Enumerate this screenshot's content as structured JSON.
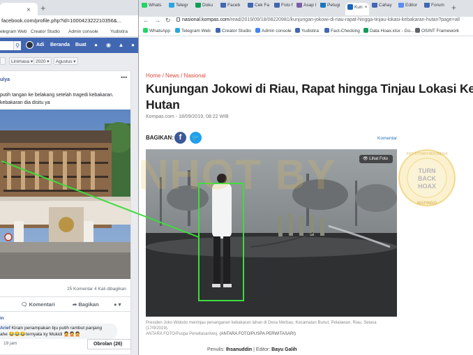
{
  "left_window": {
    "tab_close": "×",
    "tab_new": "+",
    "url": "facebook.com/profile.php?id=100042322210356&...",
    "bookmarks": [
      "elegram Web",
      "Creator Studio",
      "Admin console",
      "Yudistira"
    ],
    "fb_search_icon": "search-icon",
    "fb_user": "Adi",
    "fb_nav": [
      "Beranda",
      "Buat"
    ],
    "filters": [
      "Linimasa",
      "2020",
      "Agustus"
    ],
    "post": {
      "name": "ulya",
      "more": "•••",
      "text_line1": "putih tangan ke belakang setelah tragedi kebakaran.",
      "text_line2": "kebakaran dia disitu ya",
      "counts": "25 Komentar  4 Kali dibagikan",
      "action_comment": "Komentari",
      "action_share": "Bagikan",
      "comment_header": "in",
      "comment_author": "Arief",
      "comment_text": " Kirain penampakan bju putih rambut panjang",
      "comment_text2": "ahe 😂😂😂ternyata ky Mukidi 🤦🤦🤦",
      "comment_time": "19 jam",
      "chat_label": "Obrolan (26)"
    }
  },
  "right_window": {
    "tabs": [
      {
        "label": "Whats",
        "color": "#25d366"
      },
      {
        "label": "Telegr",
        "color": "#2ca5e0"
      },
      {
        "label": "Doku",
        "color": "#0f9d58"
      },
      {
        "label": "Faceb",
        "color": "#4267b2"
      },
      {
        "label": "Cek Fa",
        "color": "#4267b2"
      },
      {
        "label": "Foto f",
        "color": "#4267b2"
      },
      {
        "label": "Asap l",
        "color": "#7b5ea7"
      },
      {
        "label": "Petugi",
        "color": "#1b75bc"
      },
      {
        "label": "Kun",
        "color": "#1565c0"
      },
      {
        "label": "Cahay",
        "color": "#4267b2"
      },
      {
        "label": "Editor",
        "color": "#5a8dee"
      },
      {
        "label": "Forum",
        "color": "#4267b2"
      }
    ],
    "tab_new": "+",
    "back_icon": "←",
    "forward_icon": "→",
    "reload_icon": "↻",
    "url_host": "nasional.kompas.com",
    "url_path": "/read/2019/09/18/08220981/kunjungan-jokowi-di-riau-rapat-hingga-tinjau-lokasi-kebakaran-hutan?page=all",
    "bookmarks": [
      {
        "label": "WhatsApp",
        "color": "#25d366"
      },
      {
        "label": "Telegram Web",
        "color": "#2ca5e0"
      },
      {
        "label": "Creator Studio",
        "color": "#4267b2"
      },
      {
        "label": "Admin console",
        "color": "#4285f4"
      },
      {
        "label": "Yudistira",
        "color": "#4267b2"
      },
      {
        "label": "Fact-Checking",
        "color": "#4267b2"
      },
      {
        "label": "Data Hoax.xlsx - Go...",
        "color": "#0f9d58"
      },
      {
        "label": "OSINT Framework",
        "color": "#5f6368"
      }
    ],
    "breadcrumb": "Home / News / Nasional",
    "headline_line1": "Kunjungan Jokowi di Riau, Rapat hingga Tinjau Lokasi Kebakaran",
    "headline_line2": "Hutan",
    "meta": "Kompas.com - 18/09/2019, 08:22 WIB",
    "share_label": "BAGIKAN:",
    "fb_share": "f",
    "tw_share": "🐦",
    "komentar": "Komentar",
    "lihat_foto": "👁 Lihat Foto",
    "caption": "Presiden Joko Widodo meninjau penanganan kebakaran lahan di Desa Merbau, Kecamatan Bunut, Pelalawan, Riau, Selasa (17/9/2019).",
    "caption_credit": "ANTARA FOTO/Puspa Perwitasari/wsj.",
    "caption_credit_bold": "(ANTARA FOTO/PUSPA PERWITASARI)",
    "penulis_label": "Penulis: ",
    "penulis": "Ihsanuddin",
    "editor_label": " | Editor: ",
    "editor": "Bayu Galih"
  },
  "watermark": {
    "text": "NHOT BY",
    "seal_lines": [
      "TURN",
      "BACK",
      "HOAX"
    ],
    "seal_ring_top": "ANTI FITNAH INDONESIA",
    "seal_ring_bottom": "MAFINDO"
  },
  "colors": {
    "fb_blue": "#4267b2",
    "kompas_red": "#dc4b3a",
    "highlight_green": "#3ddc3d"
  }
}
